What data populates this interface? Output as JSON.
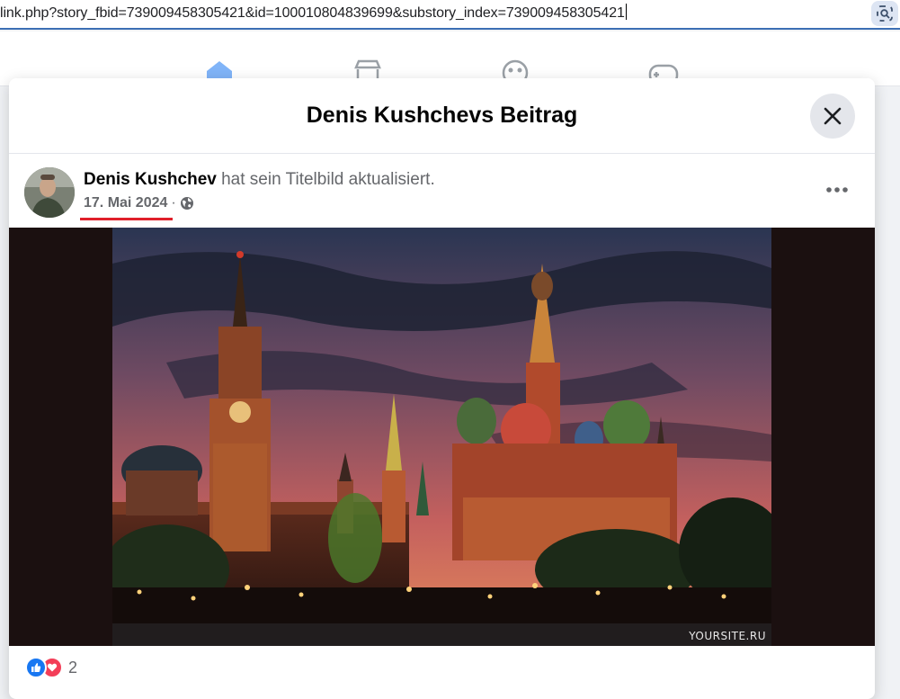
{
  "browser": {
    "url": "link.php?story_fbid=739009458305421&id=100010804839699&substory_index=739009458305421",
    "lens_icon": "lens-search-icon"
  },
  "modal": {
    "title": "Denis Kushchevs Beitrag",
    "close_icon": "close-icon"
  },
  "post": {
    "author": "Denis Kushchev",
    "action": "hat sein Titelbild aktualisiert.",
    "date": "17. Mai 2024",
    "separator": "·",
    "privacy_icon": "globe-icon",
    "more_icon": "more-dots-icon",
    "watermark": "YOURSITE.RU"
  },
  "reactions": {
    "count": "2",
    "icons": [
      "like-icon",
      "love-icon"
    ]
  },
  "colors": {
    "facebook_blue": "#1877f2",
    "love_red": "#f33e58",
    "highlight_red": "#e0202a"
  }
}
